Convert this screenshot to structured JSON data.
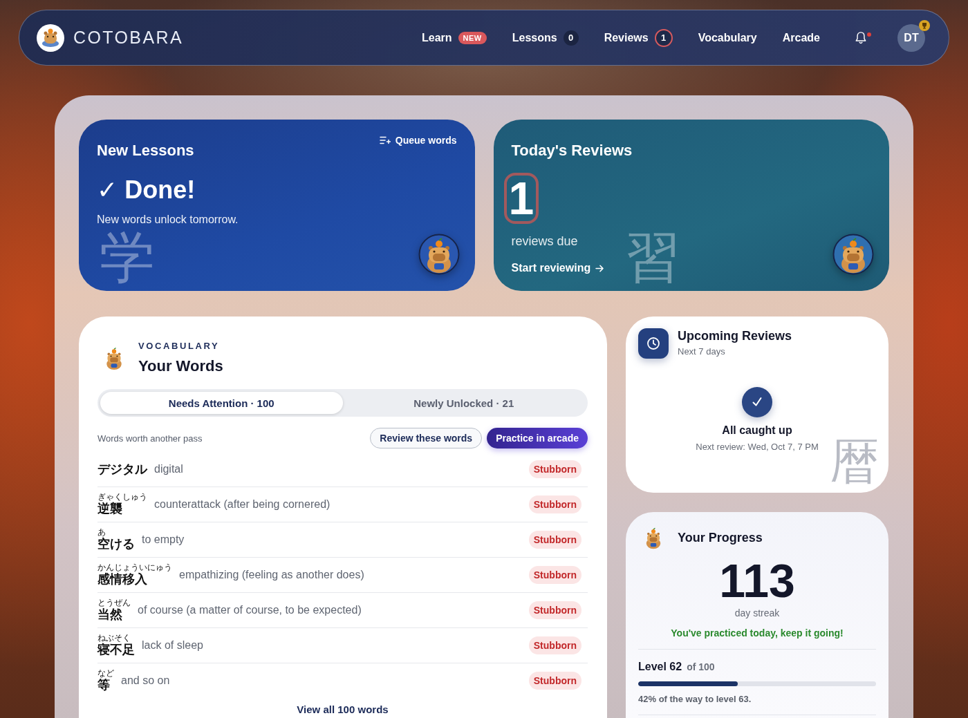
{
  "header": {
    "brand": "COTOBARA",
    "nav": [
      {
        "label": "Learn",
        "badge": {
          "text": "NEW",
          "kind": "new"
        }
      },
      {
        "label": "Lessons",
        "badge": {
          "text": "0",
          "kind": "count"
        }
      },
      {
        "label": "Reviews",
        "badge": {
          "text": "1",
          "kind": "alert"
        }
      },
      {
        "label": "Vocabulary"
      },
      {
        "label": "Arcade"
      }
    ],
    "notifications": {
      "unread": true
    },
    "avatar": {
      "initials": "DT",
      "badge": true
    }
  },
  "lessons_card": {
    "title": "New Lessons",
    "action": "Queue words",
    "status": "✓ Done!",
    "message": "New words unlock tomorrow.",
    "watermark": "学"
  },
  "reviews_card": {
    "title": "Today's Reviews",
    "count": "1",
    "count_focused": true,
    "caption": "reviews due",
    "action": "Start reviewing",
    "watermark": "習"
  },
  "vocabulary": {
    "eyebrow": "VOCABULARY",
    "title": "Your Words",
    "tabs": [
      {
        "label": "Needs Attention · 100",
        "selected": true
      },
      {
        "label": "Newly Unlocked · 21",
        "selected": false
      }
    ],
    "subtitle": "Words worth another pass",
    "buttons": [
      {
        "label": "Review these words",
        "kind": "outline"
      },
      {
        "label": "Practice in arcade",
        "kind": "primary"
      }
    ],
    "words": [
      {
        "word": "デジタル",
        "meaning": "digital",
        "tag": "Stubborn"
      },
      {
        "word": "逆襲",
        "reading": "ぎゃくしゅう",
        "meaning": "counterattack (after being cornered)",
        "tag": "Stubborn"
      },
      {
        "word": "空ける",
        "reading": "あ",
        "meaning": "to empty",
        "tag": "Stubborn"
      },
      {
        "word": "感情移入",
        "reading": "かんじょういにゅう",
        "meaning": "empathizing (feeling as another does)",
        "tag": "Stubborn"
      },
      {
        "word": "当然",
        "reading": "とうぜん",
        "meaning": "of course (a matter of course, to be expected)",
        "tag": "Stubborn"
      },
      {
        "word": "寝不足",
        "reading": "ねぶそく",
        "meaning": "lack of sleep",
        "tag": "Stubborn"
      },
      {
        "word": "等",
        "reading": "など",
        "meaning": "and so on",
        "tag": "Stubborn"
      }
    ],
    "footer_link": "View all 100 words"
  },
  "upcoming": {
    "title": "Upcoming Reviews",
    "subtitle": "Next 7 days",
    "status": "All caught up",
    "next": "Next review: Wed, Oct 7, 7 PM",
    "watermark": "暦"
  },
  "progress": {
    "title": "Your Progress",
    "streak": "113",
    "streak_label": "day streak",
    "message": "You've practiced today, keep it going!",
    "level_title": "Level 62",
    "level_of": "of 100",
    "bar": {
      "level": 0.42
    },
    "bar_text": "42% of the way to level 63."
  }
}
